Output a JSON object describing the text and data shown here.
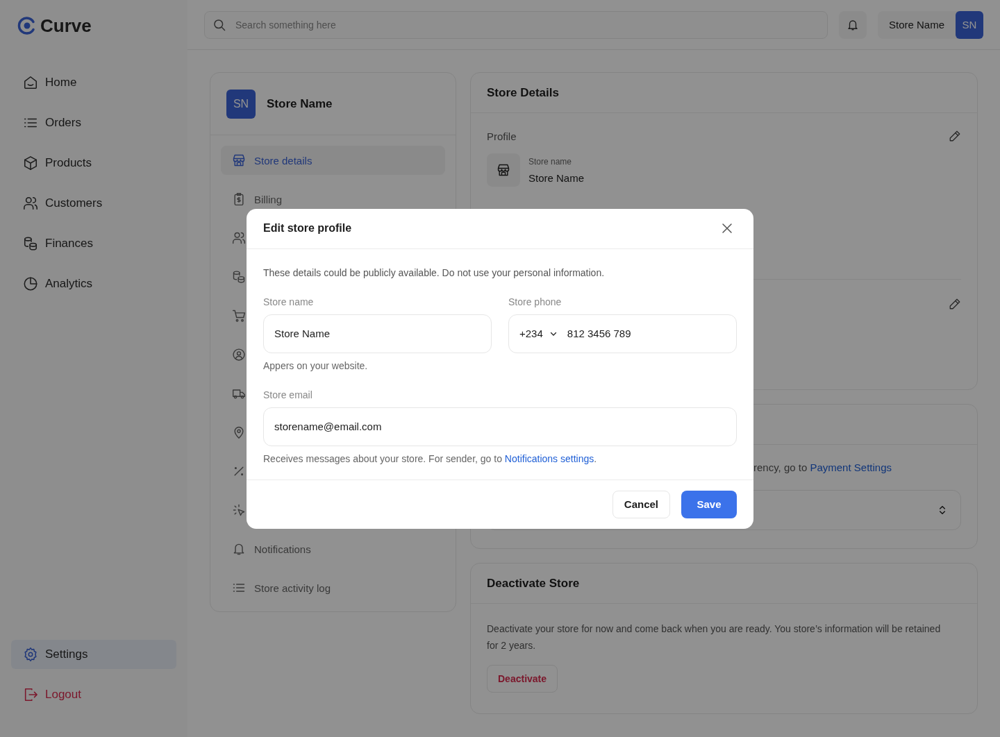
{
  "brand": {
    "name": "Curve"
  },
  "nav": [
    {
      "label": "Home",
      "selected": false
    },
    {
      "label": "Orders",
      "selected": false
    },
    {
      "label": "Products",
      "selected": false
    },
    {
      "label": "Customers",
      "selected": false
    },
    {
      "label": "Finances",
      "selected": false
    },
    {
      "label": "Analytics",
      "selected": false
    }
  ],
  "settings_item": {
    "label": "Settings",
    "selected": true
  },
  "logout": {
    "label": "Logout"
  },
  "search": {
    "placeholder": "Search something here"
  },
  "account": {
    "name": "Store Name",
    "initials": "SN"
  },
  "store_menu": {
    "initials": "SN",
    "name": "Store Name",
    "items": [
      {
        "label": "Store details",
        "selected": true
      },
      {
        "label": "Billing",
        "selected": false
      },
      {
        "selected": false
      },
      {
        "selected": false
      },
      {
        "selected": false
      },
      {
        "selected": false
      },
      {
        "selected": false
      },
      {
        "selected": false
      },
      {
        "selected": false
      },
      {
        "selected": false
      },
      {
        "label": "Notifications",
        "selected": false
      },
      {
        "label": "Store activity log",
        "selected": false
      }
    ]
  },
  "store_details": {
    "title": "Store Details",
    "profile_heading": "Profile",
    "field_label": "Store name",
    "field_value": "Store Name"
  },
  "currency_card": {
    "text": "rency, go to ",
    "link": "Payment Settings"
  },
  "deactivate": {
    "title": "Deactivate Store",
    "text": "Deactivate your store for now and come back when you are ready. You store’s information will be retained for 2 years.",
    "button": "Deactivate"
  },
  "modal": {
    "title": "Edit store profile",
    "intro": "These details could be publicly available. Do not use your personal information.",
    "store_name": {
      "label": "Store name",
      "value": "Store Name",
      "hint": "Appers on your website."
    },
    "store_phone": {
      "label": "Store phone",
      "code": "+234",
      "number": "812 3456 789"
    },
    "store_email": {
      "label": "Store email",
      "value": "storename@email.com",
      "hint": "Receives messages about your store. For sender, go to ",
      "hint_link": "Notifications settings",
      "hint_end": "."
    },
    "cancel": "Cancel",
    "save": "Save"
  }
}
